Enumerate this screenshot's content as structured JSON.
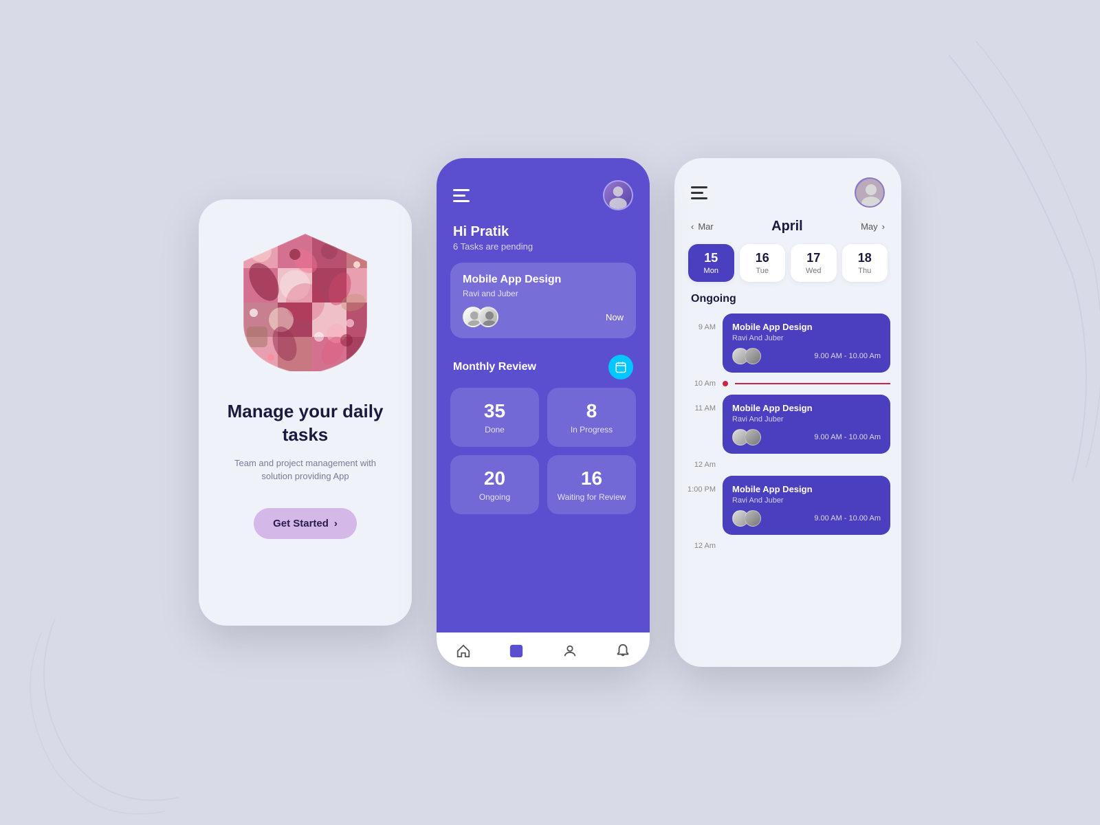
{
  "background": "#d8dae8",
  "screen1": {
    "main_title": "Manage your daily tasks",
    "sub_title": "Team and project management with solution providing App",
    "get_started_label": "Get Started",
    "chevron": "›"
  },
  "screen2": {
    "greeting_name": "Hi Pratik",
    "greeting_sub": "6 Tasks are pending",
    "task_card": {
      "title": "Mobile App Design",
      "sub": "Ravi and Juber",
      "time": "Now"
    },
    "monthly_review_label": "Monthly Review",
    "stats": [
      {
        "number": "35",
        "label": "Done"
      },
      {
        "number": "8",
        "label": "In Progress"
      },
      {
        "number": "20",
        "label": "Ongoing"
      },
      {
        "number": "16",
        "label": "Waiting for Review"
      }
    ],
    "nav_items": [
      "home",
      "tasks",
      "profile",
      "notifications"
    ]
  },
  "screen3": {
    "month_prev": "‹ Mar",
    "month_title": "April",
    "month_next": "May ›",
    "days": [
      {
        "num": "15",
        "name": "Mon",
        "active": true
      },
      {
        "num": "16",
        "name": "Tue",
        "active": false
      },
      {
        "num": "17",
        "name": "Wed",
        "active": false
      },
      {
        "num": "18",
        "name": "Thu",
        "active": false
      }
    ],
    "ongoing_label": "Ongoing",
    "events": [
      {
        "time": "9 AM",
        "title": "Mobile App Design",
        "sub": "Ravi And Juber",
        "range": "9.00 AM - 10.00 Am"
      },
      {
        "time": "11 AM",
        "title": "Mobile App Design",
        "sub": "Ravi And Juber",
        "range": "9.00 AM - 10.00 Am"
      },
      {
        "time": "1:00 PM",
        "title": "Mobile App Design",
        "sub": "Ravi And Juber",
        "range": "9.00 AM - 10.00 Am"
      }
    ],
    "divider_time": "10 Am"
  }
}
